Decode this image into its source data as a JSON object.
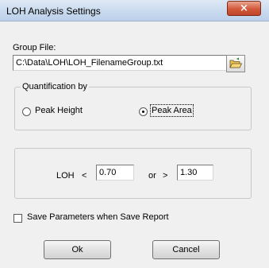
{
  "window": {
    "title": "LOH Analysis Settings",
    "close_glyph": "×"
  },
  "group_file": {
    "label": "Group File:",
    "value": "C:\\Data\\LOH\\LOH_FilenameGroup.txt",
    "browse_icon": "open-folder-icon"
  },
  "quantification": {
    "caption": "Quantification by",
    "options": [
      {
        "label": "Peak Height",
        "selected": false
      },
      {
        "label": "Peak Area",
        "selected": true
      }
    ]
  },
  "threshold": {
    "label": "LOH",
    "lt_symbol": "<",
    "low_value": "0.70",
    "or_label": "or",
    "gt_symbol": ">",
    "high_value": "1.30"
  },
  "save_params": {
    "label": "Save Parameters when  Save Report",
    "checked": false
  },
  "buttons": {
    "ok": "Ok",
    "cancel": "Cancel"
  }
}
